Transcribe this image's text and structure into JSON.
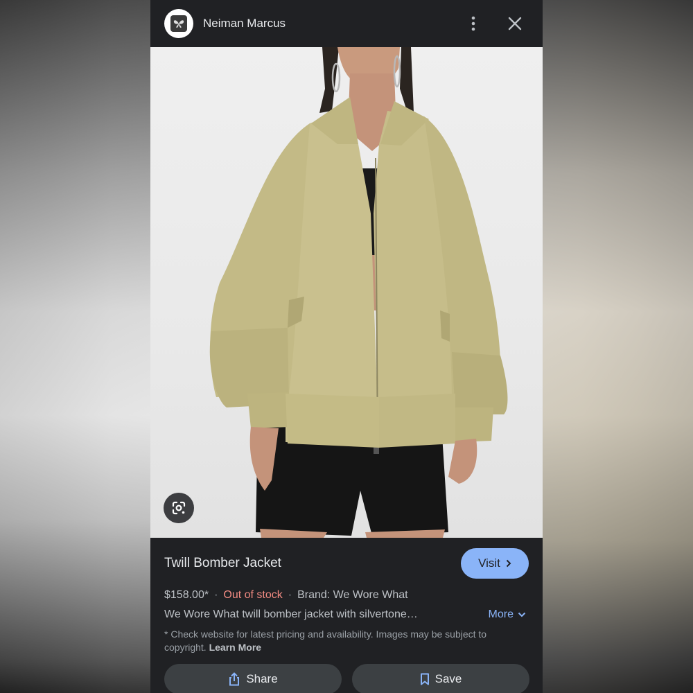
{
  "header": {
    "site_name": "Neiman Marcus",
    "logo_icon": "butterfly-logo-icon",
    "menu_icon": "more-vert-icon",
    "close_icon": "close-icon"
  },
  "image": {
    "alt": "Twill Bomber Jacket",
    "lens_icon": "google-lens-icon"
  },
  "product": {
    "title": "Twill Bomber Jacket",
    "visit_label": "Visit",
    "price": "$158.00*",
    "stock_status": "Out of stock",
    "brand": "Brand: We Wore What",
    "separator": "·",
    "description": "We Wore What twill bomber jacket with silvertone…",
    "more_label": "More",
    "disclaimer": "* Check website for latest pricing and availability. Images may be subject to copyright.",
    "learn_more": "Learn More"
  },
  "actions": {
    "share_label": "Share",
    "save_label": "Save"
  },
  "colors": {
    "background": "#202124",
    "accent": "#8ab4f8",
    "out_of_stock": "#f28b82",
    "jacket": "#c9c08e"
  }
}
